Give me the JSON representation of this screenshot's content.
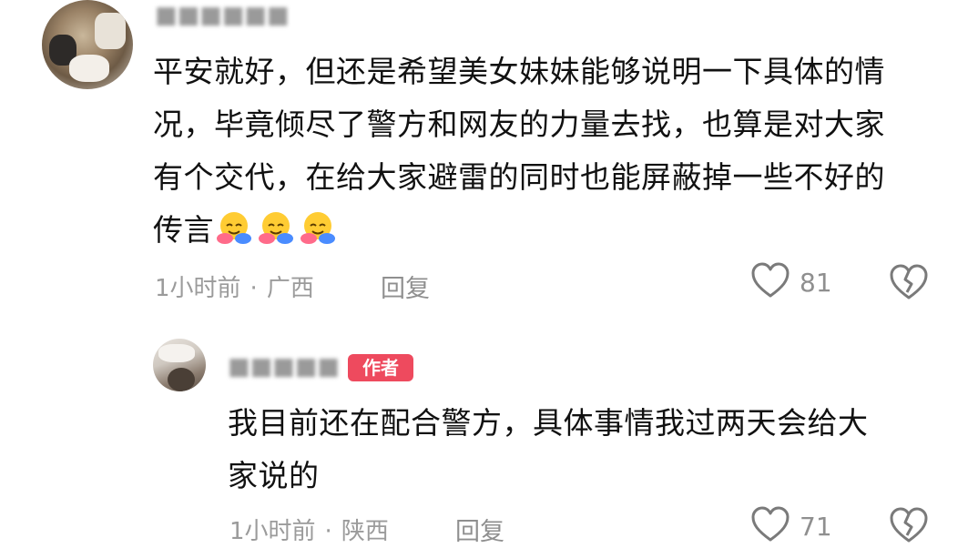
{
  "comments": [
    {
      "text_lines": [
        "平安就好，但还是希望美女妹妹能够说明一下具体的情",
        "况，毕竟倾尽了警方和网友的力量去找，也算是对大家",
        "有个交代，在给大家避雷的同时也能屏蔽掉一些不好的",
        "传言"
      ],
      "emojis": [
        "hug-emoji",
        "hug-emoji",
        "hug-emoji"
      ],
      "time": "1小时前",
      "separator": "·",
      "region": "广西",
      "reply_label": "回复",
      "likes": "81"
    },
    {
      "author_badge": "作者",
      "text_lines": [
        "我目前还在配合警方，具体事情我过两天会给大",
        "家说的"
      ],
      "time": "1小时前",
      "separator": "·",
      "region": "陕西",
      "reply_label": "回复",
      "likes": "71"
    }
  ],
  "colors": {
    "badge": "#ee4a5e",
    "meta_text": "#9b9b9b",
    "body_text": "#111111"
  }
}
